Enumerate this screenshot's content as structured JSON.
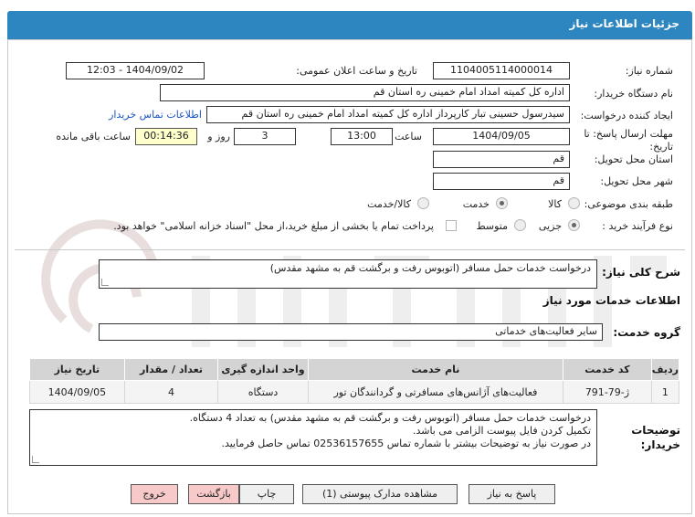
{
  "header": {
    "title": "جزئیات اطلاعات نیاز"
  },
  "form": {
    "need_number_label": "شماره نیاز:",
    "need_number": "1104005114000014",
    "announce_label": "تاریخ و ساعت اعلان عمومی:",
    "announce_value": "1404/09/02 - 12:03",
    "buyer_org_label": "نام دستگاه خریدار:",
    "buyer_org": "اداره کل کمیته امداد امام خمینی  ره  استان قم",
    "creator_label": "ایجاد کننده درخواست:",
    "creator": "سیدرسول حسینی تبار کارپرداز اداره کل کمیته امداد امام خمینی  ره  استان قم",
    "contact_link": "اطلاعات تماس خریدار",
    "deadline_label": "مهلت ارسال پاسخ: تا تاریخ:",
    "deadline_date": "1404/09/05",
    "hour_label": "ساعت",
    "deadline_time": "13:00",
    "days_value": "3",
    "days_label": "روز و",
    "remaining_time": "00:14:36",
    "remaining_label": "ساعت باقی مانده",
    "province_label": "استان محل تحویل:",
    "province": "قم",
    "city_label": "شهر محل تحویل:",
    "city": "قم",
    "category_label": "طبقه بندی موضوعی:",
    "category_options": [
      "کالا",
      "خدمت",
      "کالا/خدمت"
    ],
    "category_selected": "خدمت",
    "purchase_label": "نوع فرآیند خرید :",
    "purchase_options": [
      "جزیی",
      "متوسط"
    ],
    "purchase_selected": "جزیی",
    "payment_note": "پرداخت تمام یا بخشی از مبلغ خرید،از محل \"اسناد خزانه اسلامی\" خواهد بود."
  },
  "summary": {
    "label": "شرح کلی نیاز:",
    "text": "درخواست خدمات حمل مسافر (اتوبوس رفت و برگشت قم به مشهد مقدس)"
  },
  "services": {
    "section_title": "اطلاعات خدمات مورد نیاز",
    "group_label": "گروه خدمت:",
    "group_value": "سایر فعالیت‌های خدماتی",
    "columns": [
      "ردیف",
      "کد خدمت",
      "نام خدمت",
      "واحد اندازه گیری",
      "تعداد / مقدار",
      "تاریخ نیاز"
    ],
    "rows": [
      {
        "row": "1",
        "code": "ژ-79-791",
        "name": "فعالیت‌های آژانس‌های مسافرتی و گردانندگان تور",
        "unit": "دستگاه",
        "qty": "4",
        "date": "1404/09/05"
      }
    ]
  },
  "notes": {
    "label": "توضیحات خریدار:",
    "line1": "درخواست خدمات حمل مسافر (اتوبوس رفت و برگشت قم به مشهد مقدس) به تعداد 4 دستگاه.",
    "line2": "تکمیل کردن فایل پیوست الزامی می باشد.",
    "line3": "در صورت نیاز به توضیحات بیشتر با شماره تماس 02536157655 تماس حاصل فرمایید."
  },
  "buttons": {
    "reply": "پاسخ به نیاز",
    "attachments": "مشاهده مدارک پیوستی (1)",
    "print": "چاپ",
    "back": "بازگشت",
    "exit": "خروج"
  },
  "colors": {
    "header": "#2e86c1",
    "link": "#1a55c0",
    "highlight": "#ffffcc",
    "pink_button": "#f7c9c9"
  }
}
